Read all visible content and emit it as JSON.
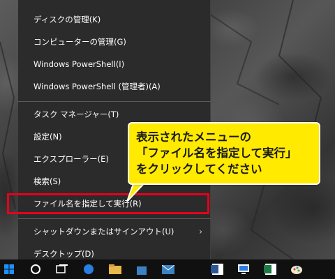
{
  "menu": {
    "items": [
      {
        "label": "ディスクの管理(K)",
        "name": "menu-item-disk-management"
      },
      {
        "label": "コンピューターの管理(G)",
        "name": "menu-item-computer-management"
      },
      {
        "label": "Windows PowerShell(I)",
        "name": "menu-item-powershell"
      },
      {
        "label": "Windows PowerShell (管理者)(A)",
        "name": "menu-item-powershell-admin"
      },
      {
        "label": "タスク マネージャー(T)",
        "name": "menu-item-task-manager"
      },
      {
        "label": "設定(N)",
        "name": "menu-item-settings"
      },
      {
        "label": "エクスプローラー(E)",
        "name": "menu-item-explorer"
      },
      {
        "label": "検索(S)",
        "name": "menu-item-search"
      },
      {
        "label": "ファイル名を指定して実行(R)",
        "name": "menu-item-run"
      },
      {
        "label": "シャットダウンまたはサインアウト(U)",
        "name": "menu-item-shutdown"
      },
      {
        "label": "デスクトップ(D)",
        "name": "menu-item-desktop"
      }
    ],
    "submenu_indicator": "›"
  },
  "callout": {
    "line1": "表示されたメニューの",
    "line2": "「ファイル名を指定して実行」",
    "line3": "をクリックしてください"
  },
  "taskbar": {
    "icons": [
      "windows-start-icon",
      "cortana-icon",
      "task-view-icon",
      "edge-icon",
      "explorer-icon",
      "store-icon",
      "mail-icon",
      "word-icon",
      "remote-desktop-icon",
      "excel-icon",
      "paint-icon"
    ]
  },
  "colors": {
    "menu_bg": "#2b2b2b",
    "highlight": "#e5001a",
    "callout_bg": "#ffea00",
    "accent_blue": "#1e90ff"
  }
}
